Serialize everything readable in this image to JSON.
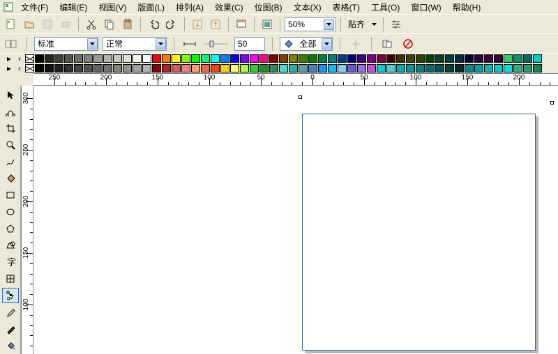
{
  "menu": {
    "file": "文件(F)",
    "edit": "编辑(E)",
    "view": "视图(V)",
    "layout": "版面(L)",
    "arrange": "排列(A)",
    "effect": "效果(C)",
    "bitmap": "位图(B)",
    "text": "文本(X)",
    "table": "表格(T)",
    "tools": "工具(O)",
    "window": "窗口(W)",
    "help": "帮助(H)"
  },
  "toolbar1": {
    "zoom": "50%",
    "snap": "贴齐"
  },
  "toolbar2": {
    "style": "标准",
    "weight": "正常",
    "value": "50",
    "scope": "全部"
  },
  "ruler_h": {
    "labels": [
      "250",
      "200",
      "150",
      "100",
      "50",
      "0",
      "50",
      "100",
      "150",
      "200"
    ]
  },
  "ruler_v": {
    "labels": [
      "300",
      "250",
      "200",
      "150",
      "100"
    ]
  },
  "palette": {
    "row1": [
      "#000000",
      "#262626",
      "#3d3d3d",
      "#545454",
      "#6b6b6b",
      "#828282",
      "#999999",
      "#b0b0b0",
      "#c7c7c7",
      "#dedede",
      "#f5f5f5",
      "#ffffff",
      "#ff0000",
      "#ff7f00",
      "#ffff00",
      "#7fff00",
      "#00ff00",
      "#00ff7f",
      "#00ffff",
      "#007fff",
      "#0000ff",
      "#7f00ff",
      "#ff00ff",
      "#ff007f",
      "#7f0000",
      "#7f3f00",
      "#7f7f00",
      "#3f7f00",
      "#007f00",
      "#007f3f",
      "#007f7f",
      "#003f7f",
      "#00007f",
      "#3f007f",
      "#7f007f",
      "#7f003f",
      "#400000",
      "#403000",
      "#404000",
      "#304000",
      "#004000",
      "#004030",
      "#004040",
      "#003040",
      "#000040",
      "#300040",
      "#400040",
      "#400030",
      "#33cc66",
      "#009966",
      "#006666",
      "#00cccc"
    ],
    "row2": [
      "#020202",
      "#121212",
      "#222222",
      "#323232",
      "#424242",
      "#525252",
      "#626262",
      "#727272",
      "#828282",
      "#929292",
      "#a2a2a2",
      "#b2b2b2",
      "#8b0000",
      "#b22222",
      "#cd5c5c",
      "#f08080",
      "#ffa07a",
      "#ff6347",
      "#ff4500",
      "#ffd700",
      "#ffff66",
      "#adff2f",
      "#32cd32",
      "#228b22",
      "#2e8b57",
      "#40e0d0",
      "#20b2aa",
      "#5f9ea0",
      "#4682b4",
      "#1e90ff",
      "#00bfff",
      "#87ceeb",
      "#6a5acd",
      "#9370db",
      "#ba55d3",
      "#00ced1",
      "#48d1cc",
      "#00b3b3",
      "#009999",
      "#008080",
      "#006b6b",
      "#005656",
      "#004242",
      "#002d2d",
      "#008b8b",
      "#00a0a0",
      "#00b5b5",
      "#00caca",
      "#00dfdf",
      "#33aa88",
      "#269973",
      "#1a7f5c"
    ]
  }
}
